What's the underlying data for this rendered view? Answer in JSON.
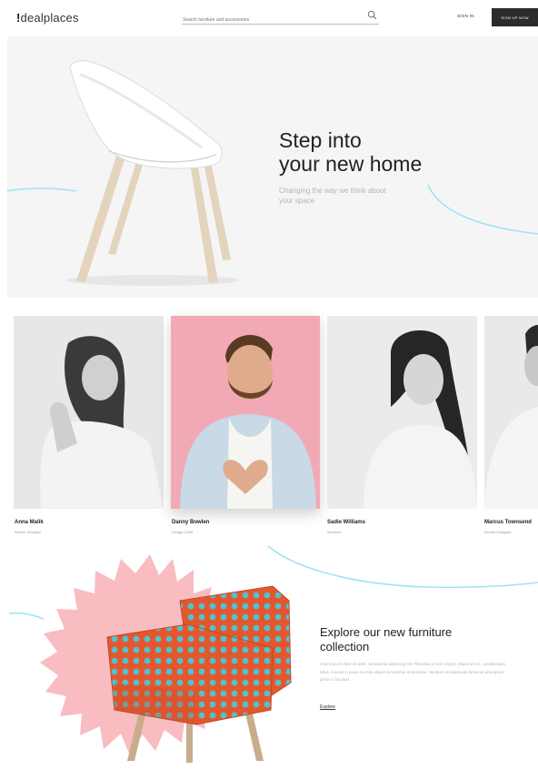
{
  "header": {
    "logo_mark": "!",
    "logo_text": "dealplaces",
    "search_placeholder": "Search furniture and accessories",
    "signin_label": "SIGN IN",
    "signup_label": "SIGN UP NOW"
  },
  "hero": {
    "title_line1": "Step into",
    "title_line2": "your new home",
    "subtitle_line1": "Changing the way we think about",
    "subtitle_line2": "your space"
  },
  "team": [
    {
      "name": "Anna Malik",
      "role": "Interior Designer"
    },
    {
      "name": "Danny Bowlen",
      "role": "Design Chief"
    },
    {
      "name": "Sadie Williams",
      "role": "Architect"
    },
    {
      "name": "Marcus Townsend",
      "role": "Interior Designer"
    }
  ],
  "collection": {
    "title_line1": "Explore our new furniture",
    "title_line2": "collection",
    "body": "Lorem ipsum dolor sit amet, consectetur adipiscing elit. Phasellus ac nisl congue, aliquet orci et, condimentum tellus. Aenean in purus ac enim aliquet consectetur at sed dolor. Interdum et malesuada fames ac ante ipsum primis in faucibus.",
    "link_label": "Explore"
  },
  "colors": {
    "accent_line": "#9fe3f3",
    "signup_bg": "#2c2c2c",
    "featured_bg": "#f2a9b6",
    "starburst": "#f8bcc1",
    "armchair": "#e4572e",
    "armchair_dots": "#4fc3cf"
  }
}
